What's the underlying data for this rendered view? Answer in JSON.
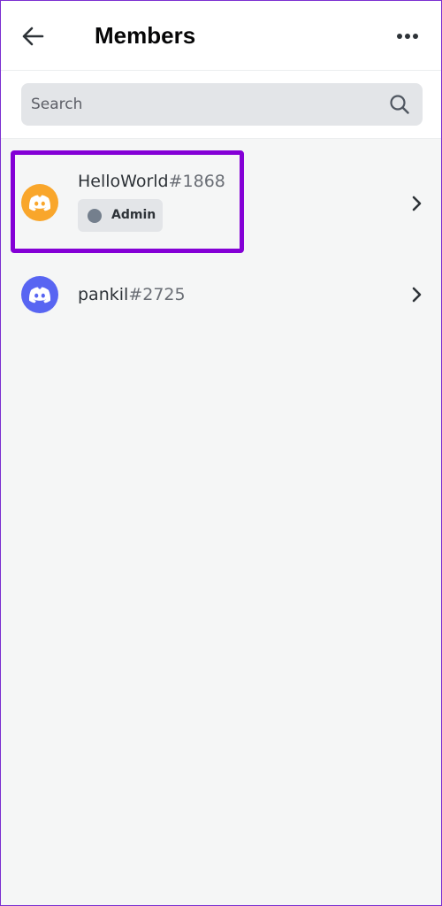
{
  "header": {
    "title": "Members",
    "back_icon": "arrow-left-icon",
    "more_icon": "more-horizontal-icon"
  },
  "search": {
    "placeholder": "Search",
    "value": "",
    "icon": "search-icon"
  },
  "members": [
    {
      "username": "HelloWorld",
      "tag": "#1868",
      "avatar_color": "#f9a62b",
      "avatar_icon": "discord-logo-icon",
      "role": {
        "label": "Admin",
        "dot_color": "#747f8d"
      },
      "highlighted": true,
      "highlight_color": "#8400d6"
    },
    {
      "username": "pankil",
      "tag": "#2725",
      "avatar_color": "#5865f2",
      "avatar_icon": "discord-logo-icon",
      "highlighted": false
    }
  ],
  "colors": {
    "page_border": "#7b2fd1",
    "background": "#f5f6f6",
    "header_background": "#ffffff",
    "search_background": "#e3e5e8"
  }
}
